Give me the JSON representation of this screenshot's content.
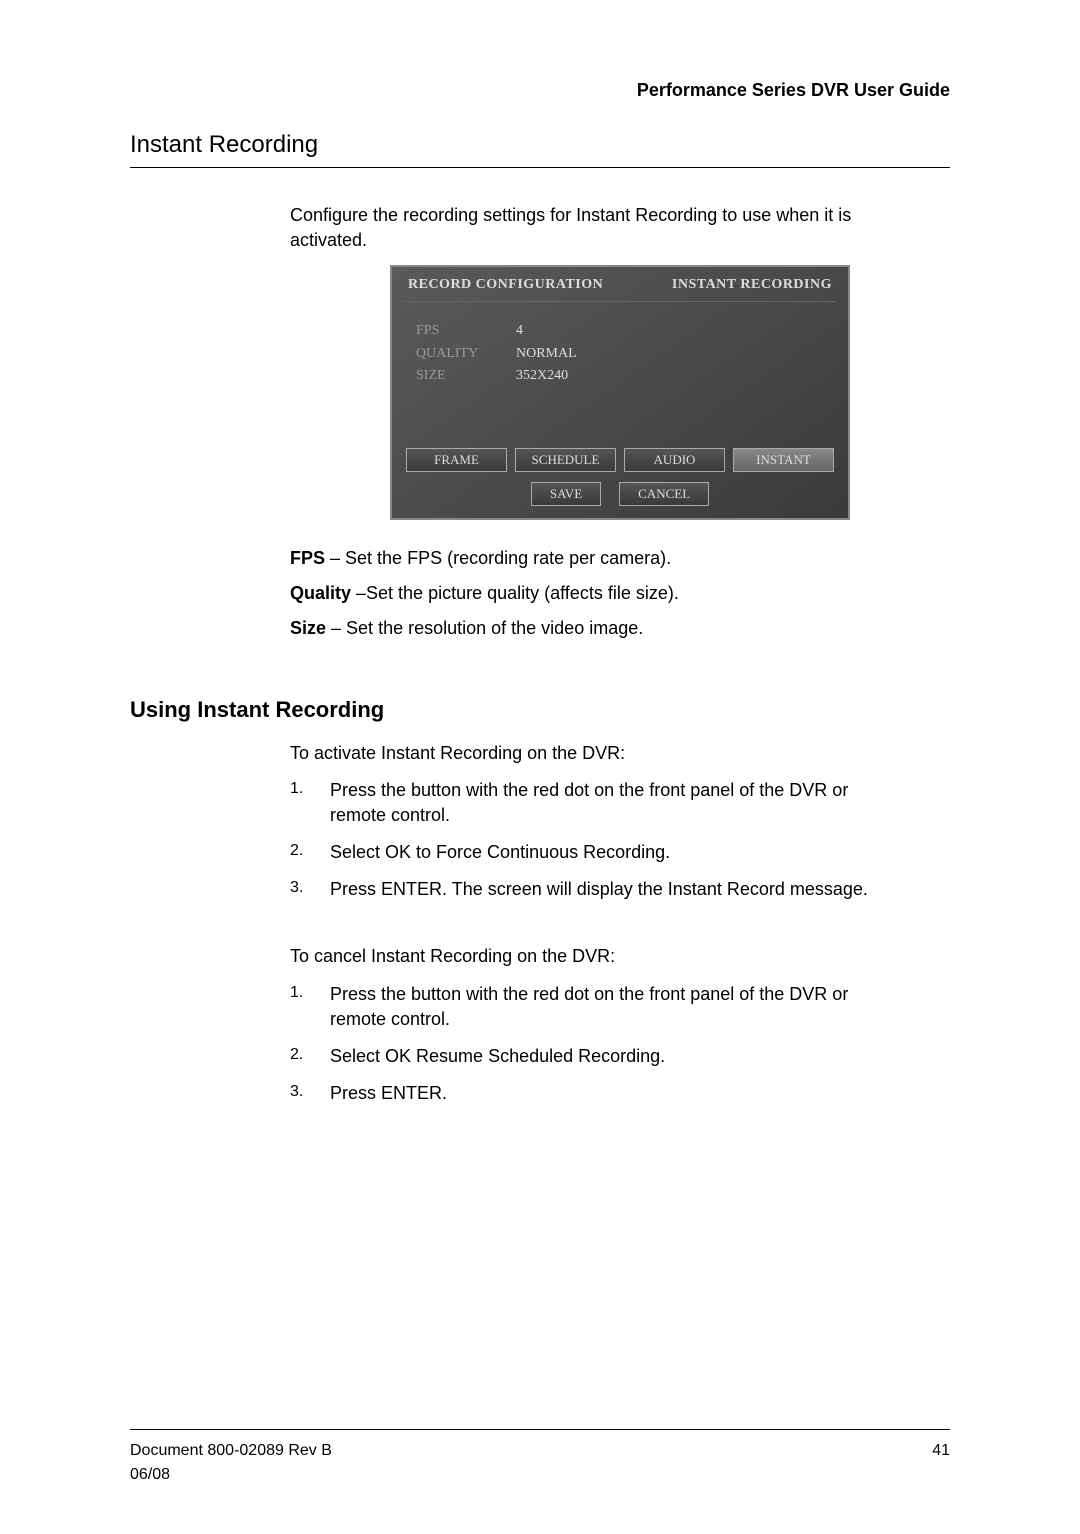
{
  "header": {
    "doc_title": "Performance Series DVR User Guide"
  },
  "section": {
    "title": "Instant Recording",
    "intro": "Configure the recording settings for Instant Recording to use when it is activated."
  },
  "screenshot": {
    "title_left": "RECORD CONFIGURATION",
    "title_right": "INSTANT RECORDING",
    "rows": [
      {
        "label": "FPS",
        "value": "4"
      },
      {
        "label": "QUALITY",
        "value": "NORMAL"
      },
      {
        "label": "SIZE",
        "value": "352X240"
      }
    ],
    "tabs": [
      {
        "label": "FRAME",
        "active": false
      },
      {
        "label": "SCHEDULE",
        "active": false
      },
      {
        "label": "AUDIO",
        "active": false
      },
      {
        "label": "INSTANT",
        "active": true
      }
    ],
    "actions": {
      "save": "SAVE",
      "cancel": "CANCEL"
    }
  },
  "definitions": [
    {
      "term": "FPS",
      "desc": " – Set the FPS (recording rate per camera)."
    },
    {
      "term": "Quality",
      "desc": " –Set the picture quality (affects file size)."
    },
    {
      "term": "Size",
      "desc": " – Set the resolution of the video image."
    }
  ],
  "subsection": {
    "title": "Using Instant Recording",
    "activate_intro": "To activate Instant Recording on the DVR:",
    "activate_steps": [
      "Press the button with the red dot on the front panel of the DVR or remote control.",
      "Select OK to Force Continuous Recording.",
      "Press ENTER. The screen will display the Instant Record message."
    ],
    "cancel_intro": "To cancel Instant Recording on the DVR:",
    "cancel_steps": [
      "Press the button with the red dot on the front panel of the DVR or remote control.",
      "Select OK Resume Scheduled Recording.",
      "Press ENTER."
    ]
  },
  "footer": {
    "doc_ref": "Document 800-02089  Rev B",
    "page": "41",
    "date": "06/08"
  }
}
